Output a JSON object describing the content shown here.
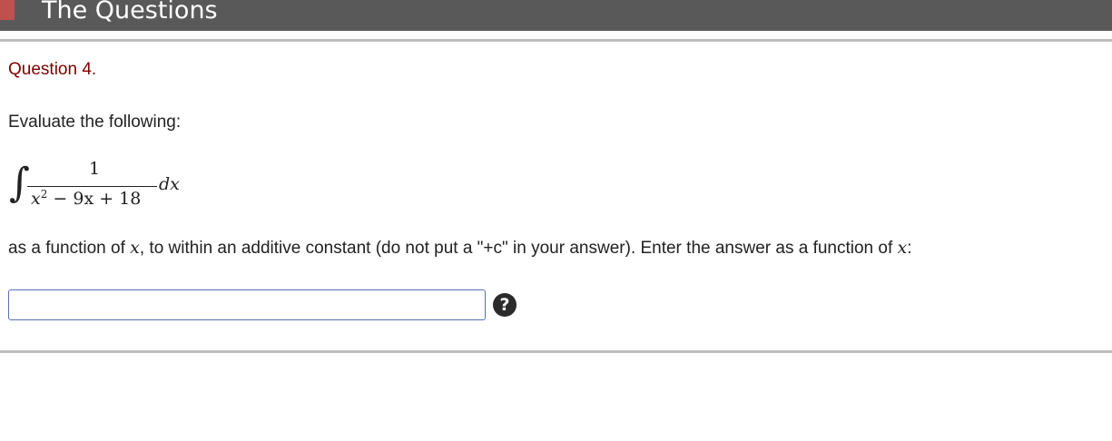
{
  "header": {
    "title": "The Questions",
    "accent_color": "#c0504d",
    "bar_color": "#595959"
  },
  "question": {
    "number_label": "Question 4.",
    "number_color": "#800000",
    "prompt": "Evaluate the following:",
    "integral": {
      "integral_sign": "∫",
      "numerator": "1",
      "denominator_x": "x",
      "denominator_exp": "2",
      "denominator_rest": " − 9x + 18",
      "differential": "dx"
    },
    "instruction_part1": "as a function of ",
    "instruction_var1": "x",
    "instruction_part2": ", to within an additive constant (do not put a \"+c\" in your answer). Enter the answer as a function of ",
    "instruction_var2": "x",
    "instruction_part3": ":"
  },
  "answer": {
    "value": "",
    "placeholder": ""
  },
  "help": {
    "icon": "question-circle-icon",
    "glyph": "?"
  }
}
